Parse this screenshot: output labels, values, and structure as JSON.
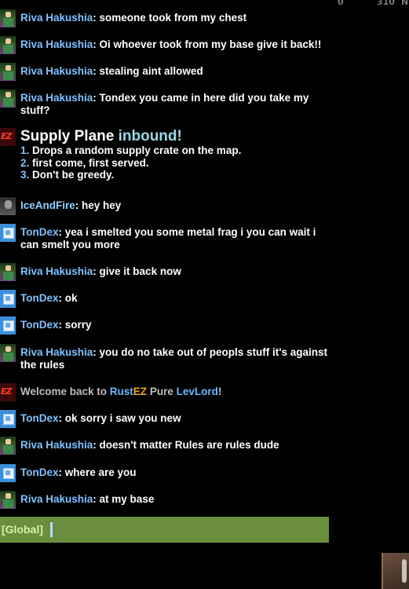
{
  "compass": {
    "left": "0",
    "mid": "310",
    "right": "N"
  },
  "messages": [
    {
      "avatar": "riva",
      "name": "Riva Hakushia",
      "text": ": someone took from my chest"
    },
    {
      "avatar": "riva",
      "name": "Riva Hakushia",
      "text": ": Oi whoever took from my base give it back!!"
    },
    {
      "avatar": "riva",
      "name": "Riva Hakushia",
      "text": ": stealing aint allowed"
    },
    {
      "avatar": "riva",
      "name": "Riva Hakushia",
      "text": ": Tondex you came in here did you take my stuff?"
    },
    {
      "avatar": "ez",
      "title_a": "Supply Plane ",
      "title_b": "inbound!",
      "items": [
        {
          "n": "1.",
          "t": " Drops a random supply crate on the map."
        },
        {
          "n": "2.",
          "t": " first come, first served."
        },
        {
          "n": "3.",
          "t": " Don't be greedy."
        }
      ]
    },
    {
      "avatar": "ice",
      "name": "IceAndFire",
      "text": ": hey hey"
    },
    {
      "avatar": "tondex",
      "name": "TonDex",
      "text": ": yea i smelted you some metal frag i you can wait i can smelt you more"
    },
    {
      "avatar": "riva",
      "name": "Riva Hakushia",
      "text": ": give it back now"
    },
    {
      "avatar": "tondex",
      "name": "TonDex",
      "text": ": ok"
    },
    {
      "avatar": "tondex",
      "name": "TonDex",
      "text": ": sorry"
    },
    {
      "avatar": "riva",
      "name": "Riva Hakushia",
      "text": ": you do no take out of peopls stuff it's against the rules"
    },
    {
      "avatar": "ez",
      "welcome_a": "Welcome back to ",
      "welcome_rust": "Rust",
      "welcome_ez": "EZ",
      "welcome_pure": " Pure ",
      "welcome_user": "LevLord",
      "welcome_end": "!"
    },
    {
      "avatar": "tondex",
      "name": "TonDex",
      "text": ": ok sorry i saw you new"
    },
    {
      "avatar": "riva",
      "name": "Riva Hakushia",
      "text": ": doesn't matter Rules are rules dude"
    },
    {
      "avatar": "tondex",
      "name": "TonDex",
      "text": ": where are you"
    },
    {
      "avatar": "riva",
      "name": "Riva Hakushia",
      "text": ": at my base"
    }
  ],
  "input": {
    "label": "[Global]"
  },
  "avatar_icons": {
    "riva": "player-avatar-icon",
    "tondex": "player-avatar-icon",
    "ice": "player-avatar-icon",
    "ez": "server-logo-icon"
  },
  "colors": {
    "name": "#7fc2ff",
    "input_bar": "#6b8e3e",
    "input_label": "#d7f0a6",
    "caret": "#b8dcff"
  }
}
